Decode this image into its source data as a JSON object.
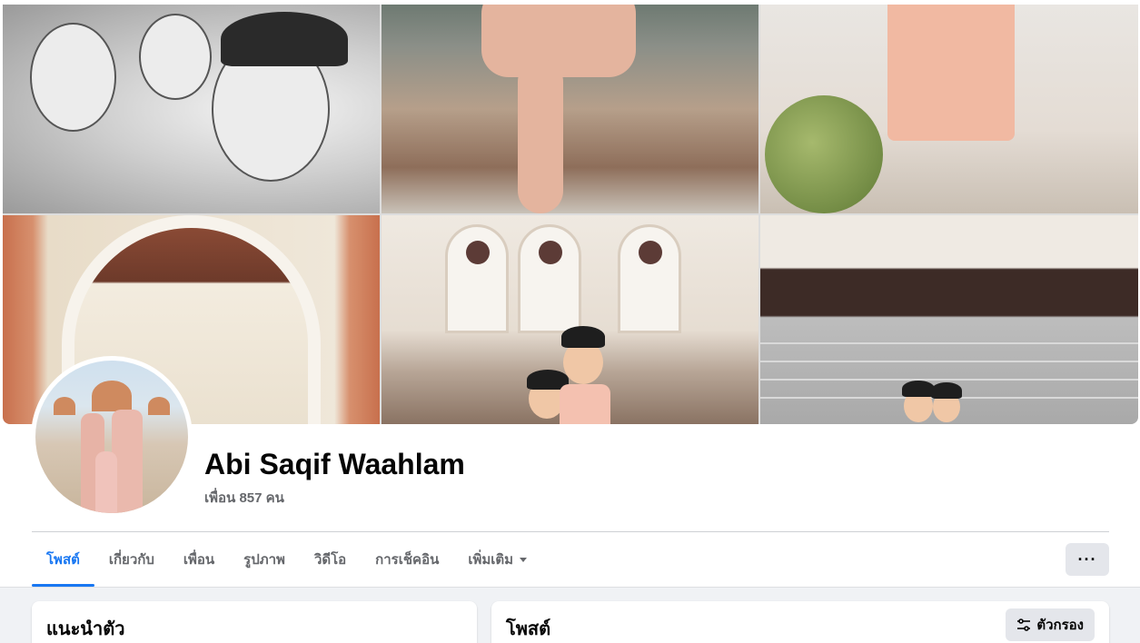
{
  "profile": {
    "name": "Abi Saqif Waahlam",
    "friends_text": "เพื่อน 857 คน"
  },
  "tabs": [
    {
      "label": "โพสต์",
      "active": true
    },
    {
      "label": "เกี่ยวกับ",
      "active": false
    },
    {
      "label": "เพื่อน",
      "active": false
    },
    {
      "label": "รูปภาพ",
      "active": false
    },
    {
      "label": "วิดีโอ",
      "active": false
    },
    {
      "label": "การเช็คอิน",
      "active": false
    },
    {
      "label": "เพิ่มเติม",
      "active": false
    }
  ],
  "more_button": {
    "icon": "ellipsis-icon",
    "label": "···"
  },
  "intro_card": {
    "title": "แนะนำตัว"
  },
  "posts_card": {
    "title": "โพสต์",
    "filter_label": "ตัวกรอง",
    "filter_icon": "filter-sliders-icon"
  },
  "colors": {
    "accent": "#1877f2",
    "secondary_text": "#65676b",
    "button_bg": "#e4e6eb",
    "feed_bg": "#f0f2f5"
  }
}
